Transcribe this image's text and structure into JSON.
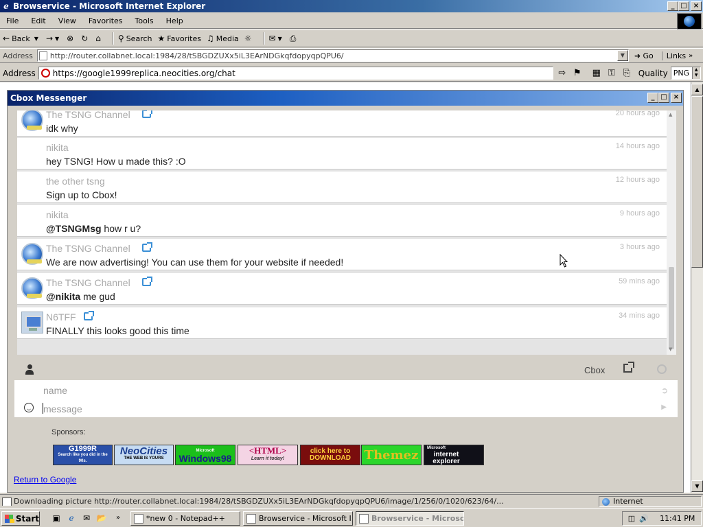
{
  "window": {
    "title": "Browservice - Microsoft Internet Explorer"
  },
  "menu": [
    "File",
    "Edit",
    "View",
    "Favorites",
    "Tools",
    "Help"
  ],
  "toolbar": {
    "back": "Back",
    "search": "Search",
    "favorites": "Favorites",
    "media": "Media"
  },
  "ie_address": {
    "label": "Address",
    "url": "http://router.collabnet.local:1984/28/tSBGDZUXx5iL3EArNDGkqfdopyqpQPU6/",
    "go": "Go",
    "links": "Links"
  },
  "app_address": {
    "label": "Address",
    "url": "https://google1999replica.neocities.org/chat",
    "quality_label": "Quality",
    "quality_value": "PNG"
  },
  "cbox": {
    "title": "Cbox Messenger",
    "messages": [
      {
        "name": "The TSNG Channel",
        "time": "20 hours ago",
        "mention": "",
        "text": "idk why",
        "avatar": "globe-icon",
        "share": true
      },
      {
        "name": "nikita",
        "time": "14 hours ago",
        "mention": "",
        "text": "hey TSNG! How u made this? :O",
        "avatar": "",
        "share": false
      },
      {
        "name": "the other tsng",
        "time": "12 hours ago",
        "mention": "",
        "text": "Sign up to Cbox!",
        "avatar": "",
        "share": false
      },
      {
        "name": "nikita",
        "time": "9 hours ago",
        "mention": "@TSNGMsg",
        "text": " how r u?",
        "avatar": "",
        "share": false
      },
      {
        "name": "The TSNG Channel",
        "time": "3 hours ago",
        "mention": "",
        "text": "We are now advertising! You can use them for your website if needed!",
        "avatar": "globe-icon",
        "share": true
      },
      {
        "name": "The TSNG Channel",
        "time": "59 mins ago",
        "mention": "@nikita",
        "text": " me gud",
        "avatar": "globe-icon",
        "share": true
      },
      {
        "name": "N6TFF",
        "time": "34 mins ago",
        "mention": "",
        "text": "FINALLY this looks good this time",
        "avatar": "computer-icon",
        "share": true
      }
    ],
    "brand": "Cbox",
    "name_placeholder": "name",
    "message_placeholder": "message"
  },
  "sponsors": {
    "label": "Sponsors:",
    "banners": [
      {
        "text": "G1999R",
        "sub": "Search like you did in the 90s.",
        "bg": "#2a4fa8",
        "fg": "#ffffff"
      },
      {
        "text": "NeoCities",
        "sub": "THE WEB IS YOURS",
        "bg": "#c7dcf3",
        "fg": "#1a3d8f"
      },
      {
        "text": "Windows98",
        "sub": "Microsoft",
        "bg": "#1bbf1b",
        "fg": "#1a1a8a"
      },
      {
        "text": "<HTML>",
        "sub": "Learn it today!",
        "bg": "#f4d4e4",
        "fg": "#b0004a"
      },
      {
        "text": "click here to DOWNLOAD",
        "sub": "",
        "bg": "#7a0d0d",
        "fg": "#ffd23b"
      },
      {
        "text": "Themez",
        "sub": "",
        "bg": "#2bd62b",
        "fg": "#e0c020"
      },
      {
        "text": "internet explorer",
        "sub": "Microsoft",
        "bg": "#101018",
        "fg": "#ffffff"
      }
    ]
  },
  "return_link": "Return to Google",
  "status": {
    "text": "Downloading picture http://router.collabnet.local:1984/28/tSBGDZUXx5iL3EArNDGkqfdopyqpQPU6/image/1/256/0/1020/623/64/...",
    "zone": "Internet"
  },
  "taskbar": {
    "start": "Start",
    "tasks": [
      "*new 0 - Notepad++",
      "Browservice - Microsoft I...",
      "Browservice - Microso..."
    ],
    "clock": "11:41 PM"
  }
}
